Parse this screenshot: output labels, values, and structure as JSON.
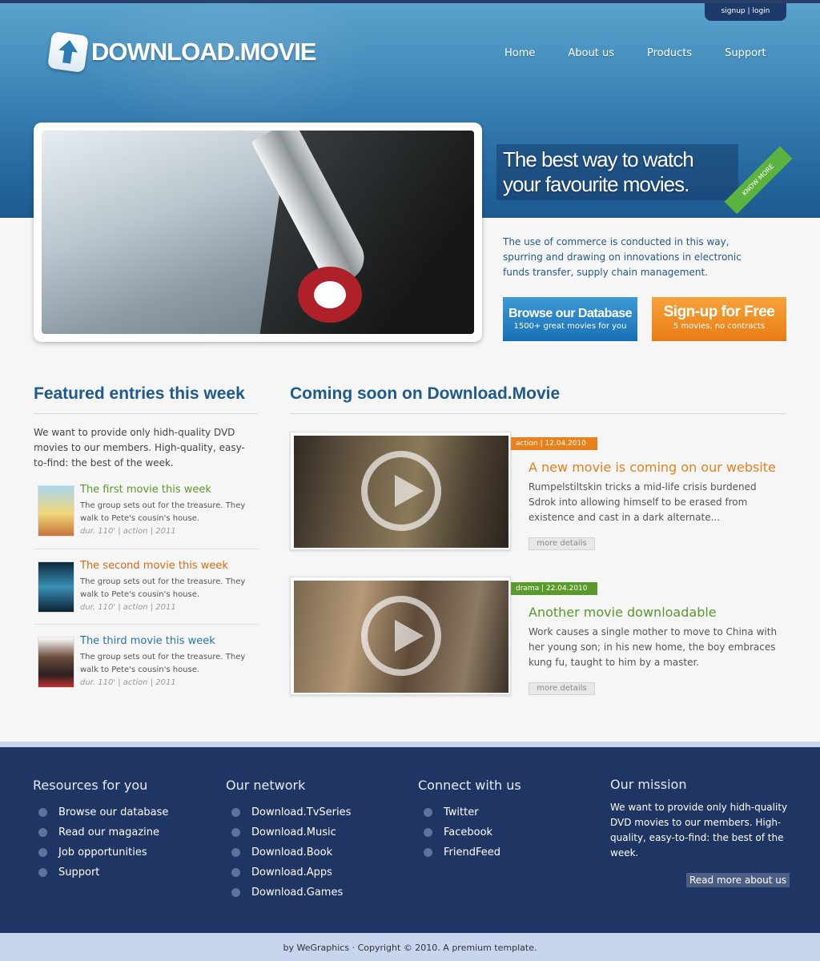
{
  "topbar": {
    "signup": "signup",
    "separator": "|",
    "login": "login"
  },
  "brand": {
    "logo_text": "DOWNLOAD.MOVIE"
  },
  "nav": [
    "Home",
    "About us",
    "Products",
    "Support"
  ],
  "hero": {
    "tagline": "The best way to watch your favourite movies.",
    "ribbon": "KNOW MORE",
    "description": "The use of commerce is conducted in this way, spurring and drawing on innovations in electronic funds transfer, supply chain management.",
    "browse": {
      "title": "Browse our Database",
      "subtitle": "1500+ great movies for you"
    },
    "signup": {
      "title": "Sign-up for Free",
      "subtitle": "5 movies, no contracts"
    }
  },
  "featured": {
    "title": "Featured entries this week",
    "intro": "We want to provide only hidh-quality DVD movies to our members. High-quality, easy-to-find: the best of the week.",
    "items": [
      {
        "title": "The first movie this week",
        "desc": "The group sets out for the treasure. They walk to Pete's cousin's house.",
        "meta": "dur. 110' | action | 2011",
        "color": "#5a9a2a"
      },
      {
        "title": "The second movie this week",
        "desc": "The group sets out for the treasure. They walk to Pete's cousin's house.",
        "meta": "dur. 110' | action | 2011",
        "color": "#d86a14"
      },
      {
        "title": "The third movie this week",
        "desc": "The group sets out for the treasure. They walk to Pete's cousin's house.",
        "meta": "dur. 110' | action | 2011",
        "color": "#2a74b0"
      }
    ]
  },
  "coming": {
    "title": "Coming soon on Download.Movie",
    "items": [
      {
        "tag": "action | 12.04.2010",
        "tag_color": "#e8801c",
        "title": "A new movie is coming on our website",
        "title_color": "#e8801c",
        "desc": "Rumpelstiltskin tricks a mid-life crisis burdened Sdrok into allowing himself to be erased from existence and cast in a dark alternate...",
        "more": "more details"
      },
      {
        "tag": "drama | 22.04.2010",
        "tag_color": "#5a9a2a",
        "title": "Another movie downloadable",
        "title_color": "#5a9a2a",
        "desc": "Work causes a single mother to move to China with her young son; in his new home, the boy embraces kung fu, taught to him by a master.",
        "more": "more details"
      }
    ]
  },
  "footer": {
    "resources": {
      "title": "Resources for you",
      "items": [
        "Browse our database",
        "Read our magazine",
        "Job opportunities",
        "Support"
      ]
    },
    "network": {
      "title": "Our network",
      "items": [
        "Download.TvSeries",
        "Download.Music",
        "Download.Book",
        "Download.Apps",
        "Download.Games"
      ]
    },
    "connect": {
      "title": "Connect with us",
      "items": [
        "Twitter",
        "Facebook",
        "FriendFeed"
      ]
    },
    "mission": {
      "title": "Our mission",
      "text": "We want to provide only hidh-quality DVD movies to our members. High-quality, easy-to-find: the best of the week.",
      "read_more": "Read more about us"
    },
    "copyright": "by WeGraphics · Copyright © 2010. A premium template."
  }
}
